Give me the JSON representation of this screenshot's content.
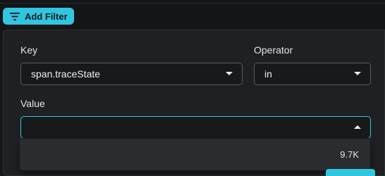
{
  "toolbar": {
    "add_filter_label": "Add Filter",
    "accent_color": "#32c5e0"
  },
  "filter_form": {
    "key_label": "Key",
    "key_value": "span.traceState",
    "operator_label": "Operator",
    "operator_value": "in",
    "value_label": "Value",
    "value_input": "",
    "value_options": [
      {
        "count": "9.7K"
      }
    ]
  },
  "icons": {
    "filter": "filter-lines-icon",
    "dropdown_closed": "caret-down-icon",
    "dropdown_open": "caret-up-icon"
  }
}
